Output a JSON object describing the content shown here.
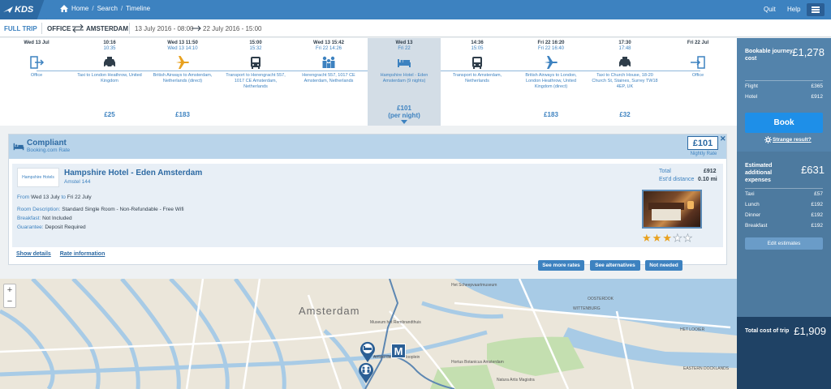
{
  "app": {
    "logo_text": "KDS"
  },
  "nav": {
    "home": "Home",
    "search": "Search",
    "timeline": "Timeline",
    "quit": "Quit",
    "help": "Help"
  },
  "trip": {
    "mode": "FULL TRIP",
    "origin": "OFFICE",
    "destination": "AMSTERDAM",
    "date_from": "13 July 2016 - 08:00",
    "date_to": "22 July 2016 - 15:00"
  },
  "timeline": [
    {
      "t1": "Wed 13 Jul",
      "t2": "",
      "icon": "exit-icon",
      "desc": "Office",
      "price": ""
    },
    {
      "t1": "10:16",
      "t2": "10:35",
      "icon": "taxi-icon",
      "desc": "Taxi to London Heathrow, United Kingdom",
      "price": "£25"
    },
    {
      "t1": "Wed 13   11:50",
      "t2": "Wed 13   14:10",
      "icon": "plane-icon",
      "desc": "British Airways to Amsterdam, Netherlands (direct)",
      "price": "£183"
    },
    {
      "t1": "15:00",
      "t2": "15:32",
      "icon": "bus-icon",
      "desc": "Transport to Herengracht 557, 1017 CE Amsterdam, Netherlands",
      "price": ""
    },
    {
      "t1": "Wed 13   15:42",
      "t2": "Fri 22   14:26",
      "icon": "meeting-icon",
      "desc": "Herengracht 557, 1017 CE Amsterdam, Netherlands",
      "price": ""
    },
    {
      "t1": "Wed 13",
      "t2": "Fri 22",
      "icon": "bed-icon",
      "desc": "Hampshire Hotel - Eden Amsterdam (9 nights)",
      "price": "£101",
      "price_sub": "(per night)"
    },
    {
      "t1": "14:36",
      "t2": "15:05",
      "icon": "bus-icon",
      "desc": "Transport to Amsterdam, Netherlands",
      "price": ""
    },
    {
      "t1": "Fri 22   16:20",
      "t2": "Fri 22   16:40",
      "icon": "plane-icon",
      "desc": "British Airways to London, London Heathrow, United Kingdom (direct)",
      "price": "£183"
    },
    {
      "t1": "17:30",
      "t2": "17:48",
      "icon": "taxi-icon",
      "desc": "Taxi to Church House, 18-20 Church St, Staines, Surrey TW18 4EP, UK",
      "price": "£32"
    },
    {
      "t1": "Fri 22 Jul",
      "t2": "",
      "icon": "enter-icon",
      "desc": "Office",
      "price": ""
    }
  ],
  "hotel": {
    "status": "Compliant",
    "rate_source": "Booking.com Rate",
    "nightly_price": "£101",
    "nightly_label": "Nightly Rate",
    "logo_text": "Hampshire Hotels",
    "name": "Hampshire Hotel - Eden Amsterdam",
    "address": "Amstel 144",
    "from_label": "From",
    "from_date": "Wed 13 July",
    "to_label": "to",
    "to_date": "Fri 22 July",
    "room_label": "Room Description:",
    "room_value": "Standard Single Room - Non-Refundable - Free Wifi",
    "breakfast_label": "Breakfast:",
    "breakfast_value": "Not Included",
    "guarantee_label": "Guarantee:",
    "guarantee_value": "Deposit Required",
    "total_label": "Total",
    "total_value": "£912",
    "distance_label": "Est'd distance",
    "distance_value": "0.10 mi",
    "stars": 3,
    "stars_max": 5,
    "show_details": "Show details",
    "rate_information": "Rate information",
    "see_more_rates": "See more rates",
    "see_alternatives": "See alternatives",
    "not_needed": "Not needed"
  },
  "map": {
    "city": "Amsterdam",
    "labels": [
      "Het Scheepvaartmuseum",
      "WITTENBURG",
      "Museum het Rembrandthuis",
      "Amsterdam Waterlooplein",
      "Hortus Botanicus Amsterdam",
      "Natura Artis Magistra",
      "OOSTERDOK",
      "EASTERN DOCKLANDS",
      "HET LOOIER"
    ],
    "marker": "M"
  },
  "sidebar": {
    "bookable_label": "Bookable journey cost",
    "bookable_value": "£1,278",
    "flight_label": "Flight",
    "flight_value": "£365",
    "hotel_label": "Hotel",
    "hotel_value": "£912",
    "book_label": "Book",
    "strange_label": "Strange result?",
    "estimated_label": "Estimated additional expenses",
    "estimated_value": "£631",
    "taxi_label": "Taxi",
    "taxi_value": "£57",
    "lunch_label": "Lunch",
    "lunch_value": "£192",
    "dinner_label": "Dinner",
    "dinner_value": "£192",
    "breakfast_label": "Breakfast",
    "breakfast_value": "£192",
    "edit_label": "Edit estimates",
    "total_label": "Total cost of trip",
    "total_value": "£1,909"
  }
}
